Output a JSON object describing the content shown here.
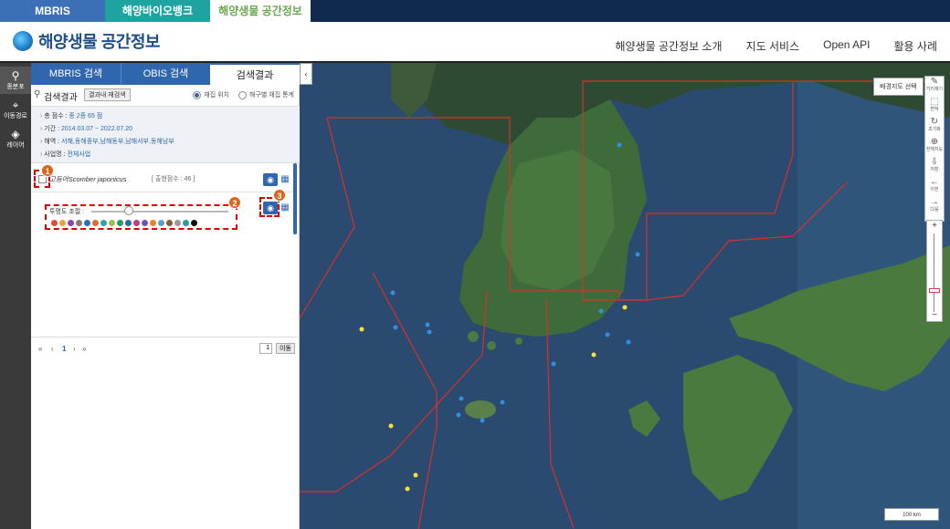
{
  "service_bar": {
    "items": [
      "MBRIS",
      "해양바이오뱅크",
      "해양생물 공간정보"
    ]
  },
  "header": {
    "logo_text": "해양생물 공간정보",
    "nav": [
      "해양생물 공간정보 소개",
      "지도 서비스",
      "Open API",
      "활용 사례"
    ]
  },
  "rail": {
    "items": [
      "종분포",
      "이동경로",
      "레이어"
    ]
  },
  "panel": {
    "tabs": [
      "MBRIS 검색",
      "OBIS 검색",
      "검색결과"
    ],
    "result_title": "검색결과",
    "refine_button": "결과내 재검색",
    "radios": [
      {
        "label": "채집 위치",
        "selected": true
      },
      {
        "label": "해구별 채집 통계",
        "selected": false
      }
    ],
    "summary": [
      {
        "key": "총 점수 : ",
        "value": "종 2종 65 점"
      },
      {
        "key": "기간 : ",
        "value": "2014.03.07 ~ 2022.07.20"
      },
      {
        "key": "해역 : ",
        "value": "서해,동해중부,남해동부,남해서부,동해남부"
      },
      {
        "key": "사업명 : ",
        "value": "전체사업"
      }
    ],
    "species": {
      "name": "고등어Scomber japonicus",
      "count": "[ 출현점수 : 46 ]"
    },
    "opacity_label": "투명도 조절 :",
    "opacity_value": 0.3,
    "palette": [
      "#e8473b",
      "#f2a13a",
      "#8e44ad",
      "#7d7d7d",
      "#2c6fb0",
      "#e06d2a",
      "#2aa7a0",
      "#a0c040",
      "#20a060",
      "#2f66ad",
      "#c03a8c",
      "#7b4fb0",
      "#f08020",
      "#5aa0d0",
      "#8a5a3a",
      "#9a9a9a",
      "#20a0a0",
      "#111111"
    ],
    "pager": {
      "first": "«",
      "prev": "‹",
      "current": "1",
      "next": "›",
      "last": "»",
      "page_input": "1",
      "go": "이동"
    }
  },
  "callouts": [
    "1",
    "2",
    "3"
  ],
  "map": {
    "basemap_button": "배경지도 선택",
    "tools": [
      "거리재기",
      "면적",
      "초기화",
      "전체지도",
      "저장",
      "이전",
      "다음"
    ],
    "zoom_in": "+",
    "zoom_out": "−",
    "scale": "100 km"
  },
  "colors": {
    "blue_point": "#2f8fe0",
    "yellow_point": "#f5e23a",
    "boundary": "#d8302a",
    "accent": "#2f66ad"
  }
}
